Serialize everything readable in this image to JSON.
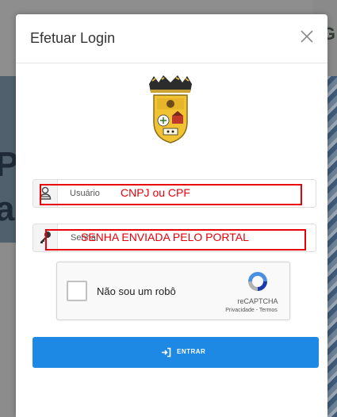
{
  "modal": {
    "title": "Efetuar Login"
  },
  "username_field": {
    "label": "Usuário",
    "annotation": "CNPJ ou CPF"
  },
  "password_field": {
    "label": "Senha",
    "annotation": "SENHA ENVIADA PELO PORTAL"
  },
  "recaptcha": {
    "label": "Não sou um robô",
    "brand": "reCAPTCHA",
    "terms": "Privacidade - Termos"
  },
  "submit": {
    "label": "ENTRAR"
  },
  "colors": {
    "primary": "#1e88e5",
    "annotation": "#e8000b"
  }
}
